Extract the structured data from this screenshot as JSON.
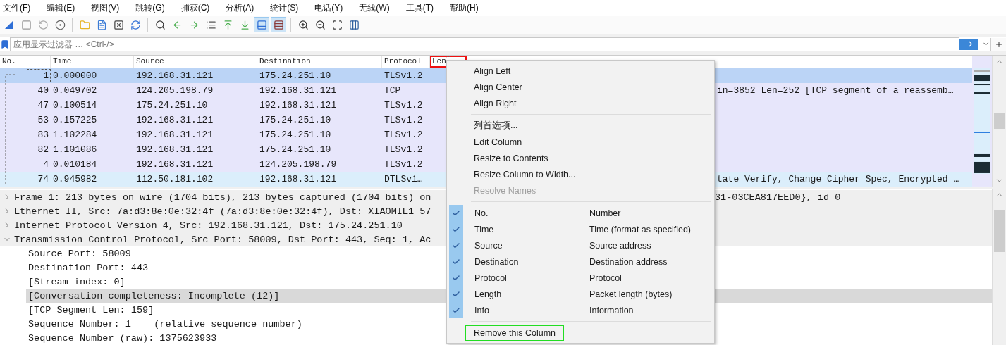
{
  "menubar": [
    "文件(F)",
    "编辑(E)",
    "视图(V)",
    "跳转(G)",
    "捕获(C)",
    "分析(A)",
    "统计(S)",
    "电话(Y)",
    "无线(W)",
    "工具(T)",
    "帮助(H)"
  ],
  "toolbar": [
    {
      "pressed": false
    },
    {
      "pressed": false
    },
    {
      "pressed": false
    },
    {
      "pressed": false
    },
    {
      "pressed": false
    },
    {
      "pressed": false
    },
    {
      "pressed": false
    },
    {
      "pressed": false
    },
    {
      "pressed": false
    },
    {
      "pressed": false
    },
    {
      "pressed": false
    },
    {
      "pressed": false
    },
    {
      "pressed": false
    },
    {
      "pressed": false
    },
    {
      "pressed": true
    },
    {
      "pressed": true
    },
    {
      "pressed": false
    },
    {
      "pressed": false
    },
    {
      "pressed": false
    },
    {
      "pressed": false
    }
  ],
  "filter": {
    "placeholder": "应用显示过滤器 … <Ctrl-/>"
  },
  "packet_list": {
    "columns": [
      {
        "label": "No.",
        "annotated": false
      },
      {
        "label": "Time",
        "annotated": false
      },
      {
        "label": "Source",
        "annotated": false
      },
      {
        "label": "Destination",
        "annotated": false
      },
      {
        "label": "Protocol",
        "annotated": false
      },
      {
        "label": "Len",
        "annotated": true
      }
    ],
    "rows": [
      {
        "no": "1",
        "time": "0.000000",
        "source": "192.168.31.121",
        "destination": "175.24.251.10",
        "protocol": "TLSv1.2",
        "selected": true,
        "color": "#bbd4f6"
      },
      {
        "no": "40",
        "time": "0.049702",
        "source": "124.205.198.79",
        "destination": "192.168.31.121",
        "protocol": "TCP",
        "info": "in=3852 Len=252 [TCP segment of a reassemb…",
        "selected": false,
        "color": "#e7e6fb"
      },
      {
        "no": "47",
        "time": "0.100514",
        "source": "175.24.251.10",
        "destination": "192.168.31.121",
        "protocol": "TLSv1.2",
        "selected": false,
        "color": "#e7e6fb"
      },
      {
        "no": "53",
        "time": "0.157225",
        "source": "192.168.31.121",
        "destination": "175.24.251.10",
        "protocol": "TLSv1.2",
        "selected": false,
        "color": "#e7e6fb"
      },
      {
        "no": "83",
        "time": "1.102284",
        "source": "192.168.31.121",
        "destination": "175.24.251.10",
        "protocol": "TLSv1.2",
        "selected": false,
        "color": "#e7e6fb"
      },
      {
        "no": "82",
        "time": "1.101086",
        "source": "192.168.31.121",
        "destination": "175.24.251.10",
        "protocol": "TLSv1.2",
        "selected": false,
        "color": "#e7e6fb"
      },
      {
        "no": "4",
        "time": "0.010184",
        "source": "192.168.31.121",
        "destination": "124.205.198.79",
        "protocol": "TLSv1.2",
        "selected": false,
        "color": "#e7e6fb"
      },
      {
        "no": "74",
        "time": "0.945982",
        "source": "112.50.181.102",
        "destination": "192.168.31.121",
        "protocol": "DTLSv1…",
        "info": "tate Verify, Change Cipher Spec, Encrypted …",
        "selected": false,
        "color": "#dbeefb"
      }
    ]
  },
  "details": [
    {
      "text": "Frame 1: 213 bytes on wire (1704 bits), 213 bytes captured (1704 bits) on",
      "tail": "31-03CEA817EED0}, id 0",
      "expanded": false,
      "selected": false
    },
    {
      "text": "Ethernet II, Src: 7a:d3:8e:0e:32:4f (7a:d3:8e:0e:32:4f), Dst: XIAOMIE1_57",
      "expanded": false,
      "selected": false
    },
    {
      "text": "Internet Protocol Version 4, Src: 192.168.31.121, Dst: 175.24.251.10",
      "expanded": false,
      "selected": false
    },
    {
      "text": "Transmission Control Protocol, Src Port: 58009, Dst Port: 443, Seq: 1, Ac",
      "expanded": true,
      "selected": false,
      "children": [
        {
          "text": "Source Port: 58009",
          "selected": false
        },
        {
          "text": "Destination Port: 443",
          "selected": false
        },
        {
          "text": "[Stream index: 0]",
          "selected": false
        },
        {
          "text": "[Conversation completeness: Incomplete (12)]",
          "selected": true
        },
        {
          "text": "[TCP Segment Len: 159]",
          "selected": false
        },
        {
          "text": "Sequence Number: 1    (relative sequence number)",
          "selected": false
        },
        {
          "text": "Sequence Number (raw): 1375623933",
          "selected": false
        }
      ]
    }
  ],
  "context_menu": {
    "items": [
      {
        "kind": "action",
        "label": "Align Left",
        "disabled": false,
        "annotated": false
      },
      {
        "kind": "action",
        "label": "Align Center",
        "disabled": false,
        "annotated": false
      },
      {
        "kind": "action",
        "label": "Align Right",
        "disabled": false,
        "annotated": false
      },
      {
        "kind": "separator"
      },
      {
        "kind": "action",
        "label": "列首选项...",
        "disabled": false,
        "annotated": false
      },
      {
        "kind": "action",
        "label": "Edit Column",
        "disabled": false,
        "annotated": false
      },
      {
        "kind": "action",
        "label": "Resize to Contents",
        "disabled": false,
        "annotated": false
      },
      {
        "kind": "action",
        "label": "Resize Column to Width...",
        "disabled": false,
        "annotated": false
      },
      {
        "kind": "action",
        "label": "Resolve Names",
        "disabled": true,
        "annotated": false
      },
      {
        "kind": "separator"
      },
      {
        "kind": "check",
        "label": "No.",
        "description": "Number",
        "checked": true
      },
      {
        "kind": "check",
        "label": "Time",
        "description": "Time (format as specified)",
        "checked": true
      },
      {
        "kind": "check",
        "label": "Source",
        "description": "Source address",
        "checked": true
      },
      {
        "kind": "check",
        "label": "Destination",
        "description": "Destination address",
        "checked": true
      },
      {
        "kind": "check",
        "label": "Protocol",
        "description": "Protocol",
        "checked": true
      },
      {
        "kind": "check",
        "label": "Length",
        "description": "Packet length (bytes)",
        "checked": true
      },
      {
        "kind": "check",
        "label": "Info",
        "description": "Information",
        "checked": true
      },
      {
        "kind": "separator"
      },
      {
        "kind": "action",
        "label": "Remove this Column",
        "disabled": false,
        "annotated": true
      }
    ]
  }
}
